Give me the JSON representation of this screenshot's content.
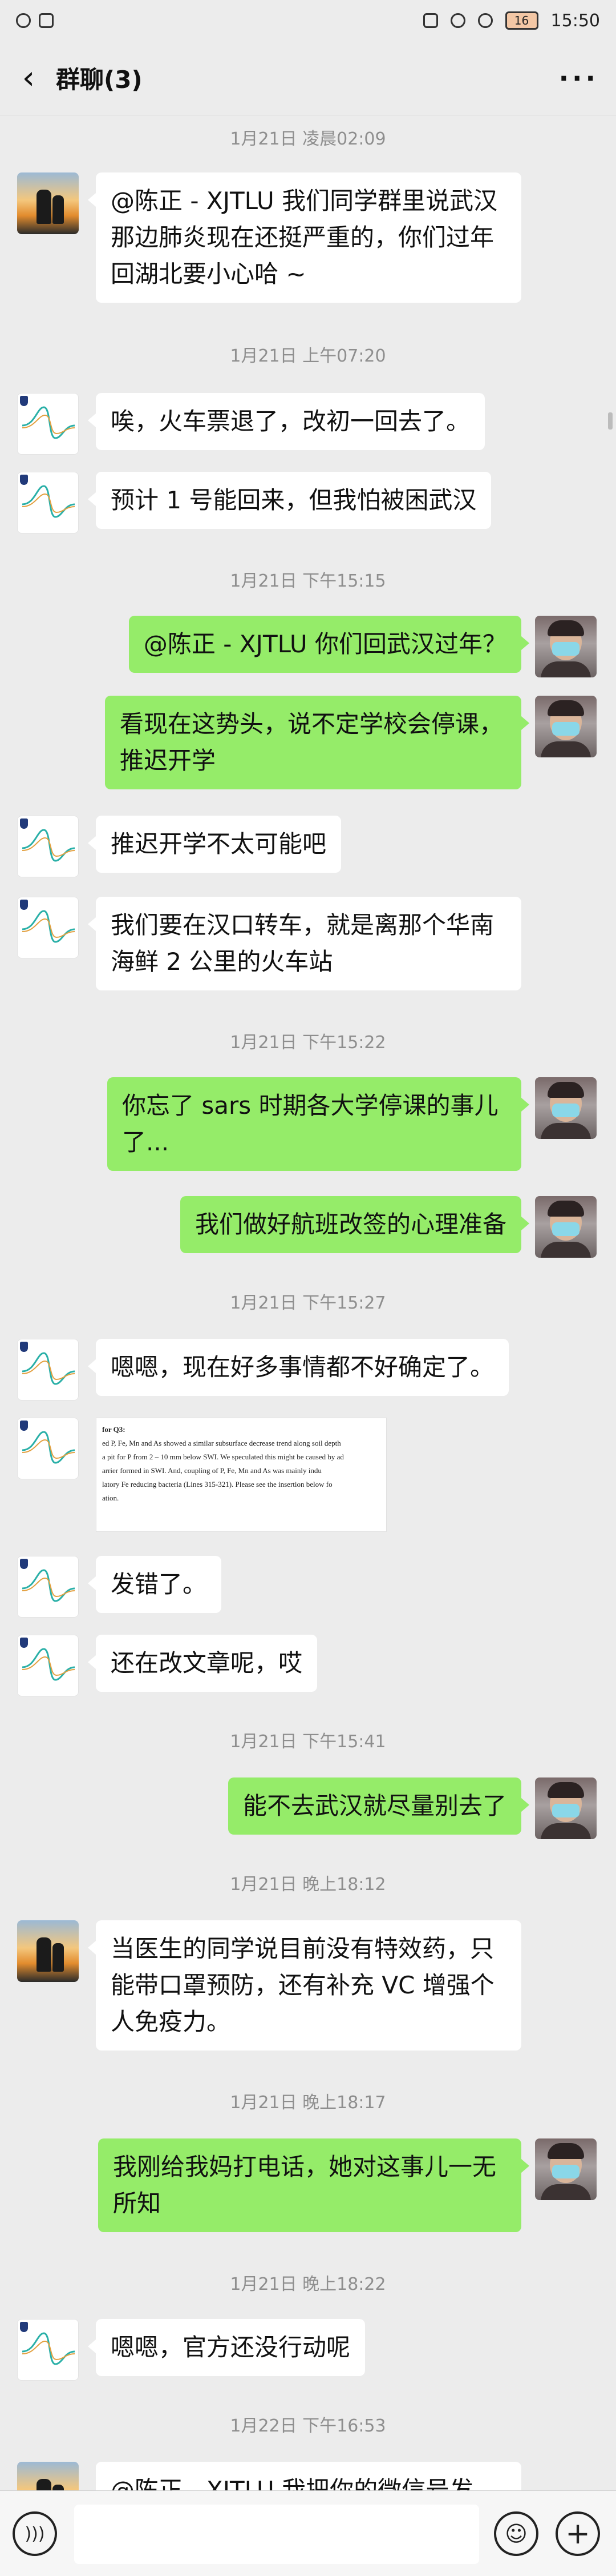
{
  "status_bar": {
    "battery": "16",
    "time": "15:50"
  },
  "header": {
    "back_icon": "chevron-left-icon",
    "title": "群聊(3)",
    "more_icon": "more-dots-icon"
  },
  "timestamps": [
    "1月21日 凌晨02:09",
    "1月21日 上午07:20",
    "1月21日 下午15:15",
    "1月21日 下午15:22",
    "1月21日 下午15:27",
    "1月21日 下午15:41",
    "1月21日 晚上18:12",
    "1月21日 晚上18:17",
    "1月21日 晚上18:22",
    "1月22日 下午16:53"
  ],
  "messages": [
    "@陈正 - XJTLU 我们同学群里说武汉那边肺炎现在还挺严重的，你们过年回湖北要小心哈 ~",
    "唉，火车票退了，改初一回去了。",
    "预计 1 号能回来，但我怕被困武汉",
    "@陈正 - XJTLU 你们回武汉过年？",
    "看现在这势头，说不定学校会停课，推迟开学",
    "推迟开学不太可能吧",
    "我们要在汉口转车，就是离那个华南海鲜 2 公里的火车站",
    "你忘了 sars 时期各大学停课的事儿了...",
    "我们做好航班改签的心理准备",
    "嗯嗯，现在好多事情都不好确定了。",
    "发错了。",
    "还在改文章呢，哎",
    "能不去武汉就尽量别去了",
    "当医生的同学说目前没有特效药，只能带口罩预防，还有补充 VC 增强个人免疫力。",
    "我刚给我妈打电话，她对这事儿一无所知",
    "嗯嗯，官方还没行动呢",
    "@陈正 - XJTLU 我把你的微信号发"
  ],
  "image_message": {
    "lines": [
      "for Q3:",
      "ed P, Fe, Mn and As showed a similar subsurface decrease trend along soil depth",
      "a pit for P from 2 – 10 mm below SWI. We speculated this might be caused by ad",
      "arrier formed in SWI. And, coupling of P, Fe, Mn and As was mainly indu",
      "latory Fe reducing bacteria (Lines 315-321). Please see the insertion below fo",
      "ation."
    ]
  },
  "input_bar": {
    "voice_icon": "voice-icon",
    "emoji_icon": "emoji-icon",
    "plus_icon": "plus-icon",
    "input_value": ""
  },
  "colors": {
    "background": "#ececec",
    "outgoing_bubble": "#95ec69",
    "incoming_bubble": "#ffffff"
  }
}
